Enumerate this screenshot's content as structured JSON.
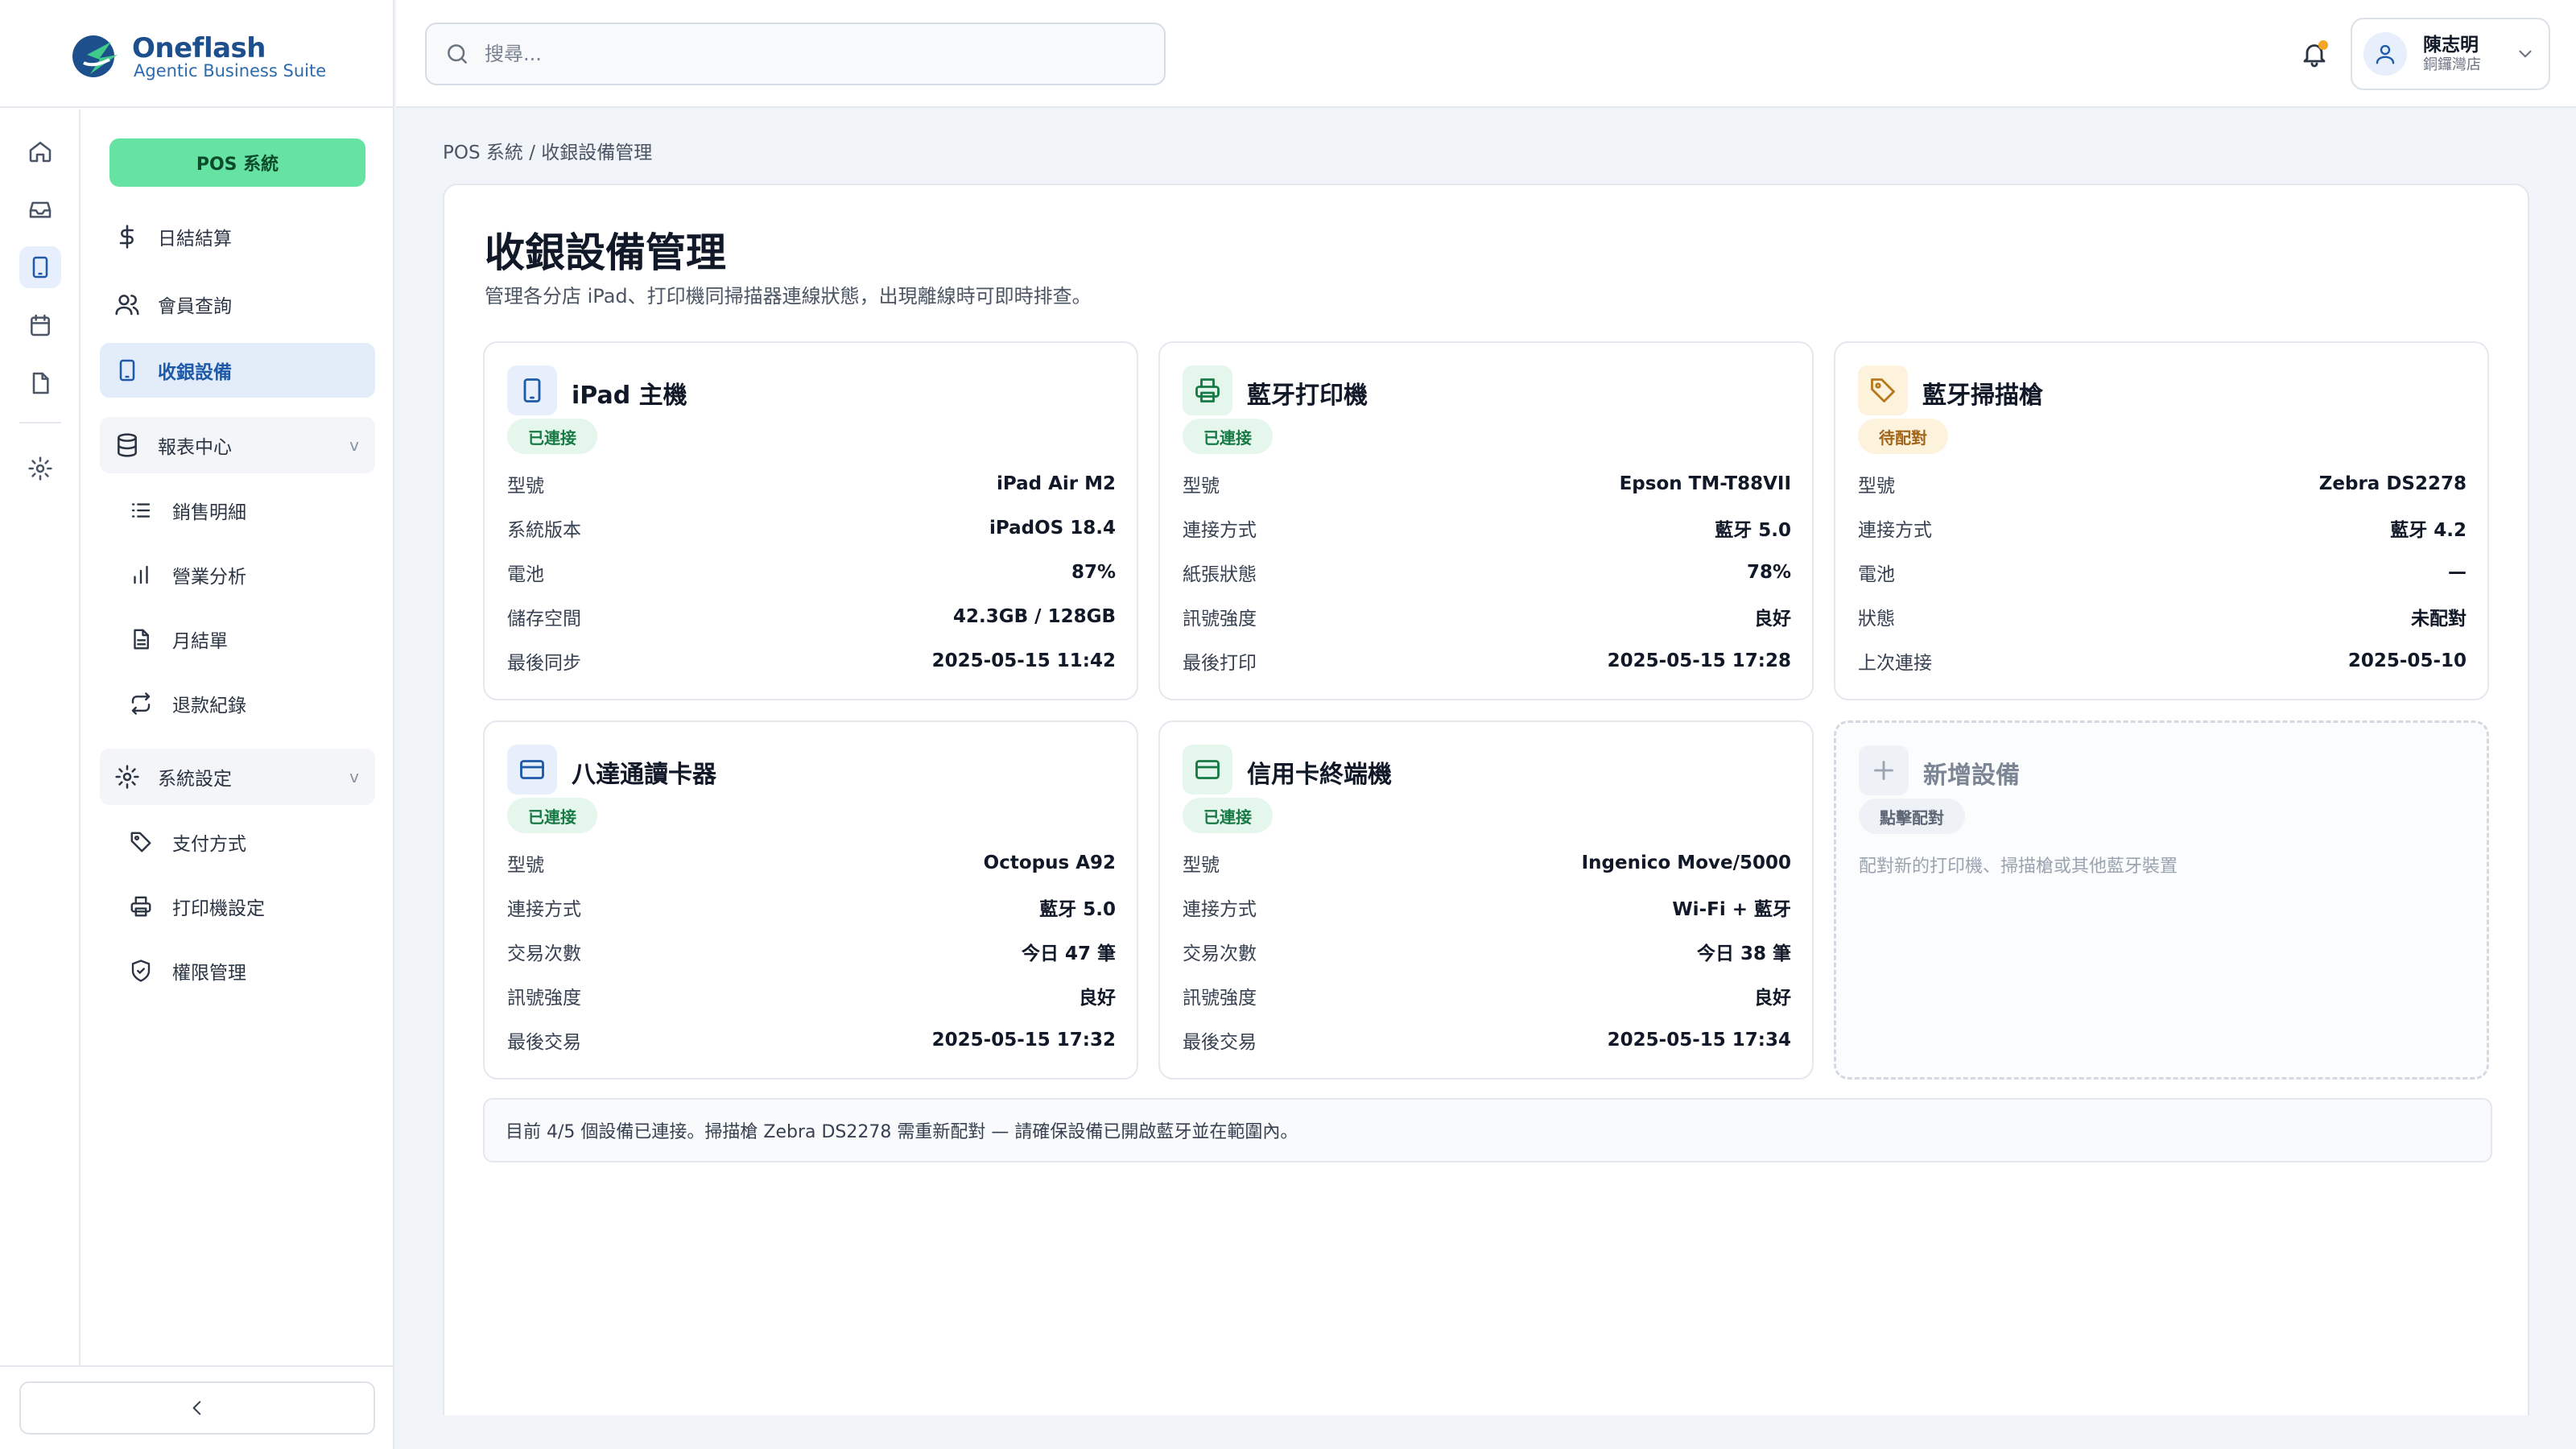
{
  "app": {
    "name": "Oneflash",
    "tagline": "Agentic Business Suite"
  },
  "header": {
    "search_placeholder": "搜尋...",
    "user": {
      "name": "陳志明",
      "role": "銅鑼灣店"
    }
  },
  "sidebar": {
    "module_label": "POS 系統",
    "items": [
      {
        "label": "日結結算",
        "icon": "dollar-icon"
      },
      {
        "label": "會員查詢",
        "icon": "users-icon"
      },
      {
        "label": "收銀設備",
        "icon": "tablet-icon",
        "active": true
      }
    ],
    "reports": {
      "label": "報表中心",
      "chevron": "v",
      "children": [
        {
          "label": "銷售明細",
          "icon": "list-icon"
        },
        {
          "label": "營業分析",
          "icon": "bar-chart-icon"
        },
        {
          "label": "月結單",
          "icon": "document-icon"
        },
        {
          "label": "退款紀錄",
          "icon": "refresh-icon"
        }
      ]
    },
    "settings": {
      "label": "系統設定",
      "chevron": "v",
      "children": [
        {
          "label": "支付方式",
          "icon": "tag-icon"
        },
        {
          "label": "打印機設定",
          "icon": "printer-icon"
        },
        {
          "label": "權限管理",
          "icon": "shield-icon"
        }
      ]
    }
  },
  "breadcrumb": "POS 系統 / 收銀設備管理",
  "page": {
    "title": "收銀設備管理",
    "description": "管理各分店 iPad、打印機同掃描器連線狀態，出現離線時可即時排查。"
  },
  "devices": [
    {
      "name": "iPad 主機",
      "icon": "tablet-icon",
      "status": "已連接",
      "rows": [
        {
          "k": "型號",
          "v": "iPad Air M2"
        },
        {
          "k": "系統版本",
          "v": "iPadOS 18.4"
        },
        {
          "k": "電池",
          "v": "87%"
        },
        {
          "k": "儲存空間",
          "v": "42.3GB / 128GB"
        },
        {
          "k": "最後同步",
          "v": "2025-05-15 11:42"
        }
      ]
    },
    {
      "name": "藍牙打印機",
      "icon": "printer-icon",
      "status": "已連接",
      "rows": [
        {
          "k": "型號",
          "v": "Epson TM-T88VII"
        },
        {
          "k": "連接方式",
          "v": "藍牙 5.0"
        },
        {
          "k": "紙張狀態",
          "v": "78%"
        },
        {
          "k": "訊號強度",
          "v": "良好"
        },
        {
          "k": "最後打印",
          "v": "2025-05-15 17:28"
        }
      ]
    },
    {
      "name": "藍牙掃描槍",
      "icon": "tag-icon",
      "status": "待配對",
      "rows": [
        {
          "k": "型號",
          "v": "Zebra DS2278"
        },
        {
          "k": "連接方式",
          "v": "藍牙 4.2"
        },
        {
          "k": "電池",
          "v": "—"
        },
        {
          "k": "狀態",
          "v": "未配對"
        },
        {
          "k": "上次連接",
          "v": "2025-05-10"
        }
      ]
    },
    {
      "name": "八達通讀卡器",
      "icon": "card-icon",
      "status": "已連接",
      "rows": [
        {
          "k": "型號",
          "v": "Octopus A92"
        },
        {
          "k": "連接方式",
          "v": "藍牙 5.0"
        },
        {
          "k": "交易次數",
          "v": "今日 47 筆"
        },
        {
          "k": "訊號強度",
          "v": "良好"
        },
        {
          "k": "最後交易",
          "v": "2025-05-15 17:32"
        }
      ]
    },
    {
      "name": "信用卡終端機",
      "icon": "card-icon",
      "status": "已連接",
      "rows": [
        {
          "k": "型號",
          "v": "Ingenico Move/5000"
        },
        {
          "k": "連接方式",
          "v": "Wi-Fi + 藍牙"
        },
        {
          "k": "交易次數",
          "v": "今日 38 筆"
        },
        {
          "k": "訊號強度",
          "v": "良好"
        },
        {
          "k": "最後交易",
          "v": "2025-05-15 17:34"
        }
      ]
    }
  ],
  "add_device": {
    "title": "新增設備",
    "badge": "點擊配對",
    "hint": "配對新的打印機、掃描槍或其他藍牙裝置"
  },
  "footer_note": "目前 4/5 個設備已連接。掃描槍 Zebra DS2278 需重新配對 — 請確保設備已開啟藍牙並在範圍內。",
  "colors": {
    "accent": "#1e5aa8",
    "module": "#66e3a3",
    "ok": "#177a44",
    "warning": "#b7791f"
  }
}
